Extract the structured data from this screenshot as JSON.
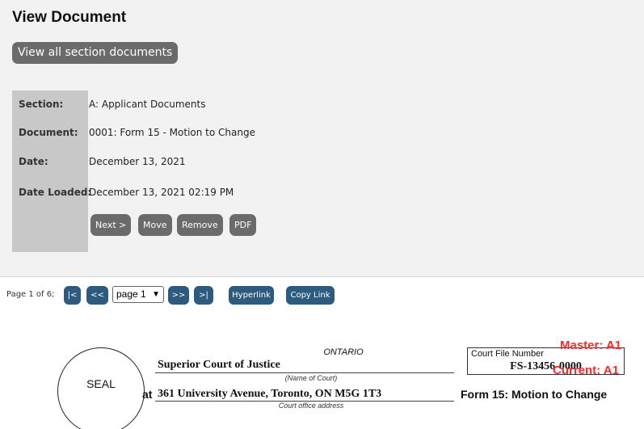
{
  "header": {
    "title": "View Document",
    "view_all_label": "View all section documents"
  },
  "meta": [
    {
      "label": "Section:",
      "value": "A: Applicant Documents"
    },
    {
      "label": "Document:",
      "value": "0001: Form 15 - Motion to Change"
    },
    {
      "label": "Date:",
      "value": "December 13, 2021"
    },
    {
      "label": "Date Loaded:",
      "value": "December 13, 2021 02:19 PM"
    }
  ],
  "actions": {
    "next": "Next >",
    "move": "Move",
    "remove": "Remove",
    "pdf": "PDF"
  },
  "pager": {
    "text": "Page 1 of 6;",
    "first": "|<",
    "prev": "<<",
    "selected_page": "page 1",
    "next": ">>",
    "last": ">|",
    "hyperlink": "Hyperlink",
    "copy_link": "Copy Link"
  },
  "document": {
    "seal": "SEAL",
    "ontario": "ONTARIO",
    "court_name": "Superior Court of Justice",
    "court_caption": "(Name of Court)",
    "at": "at",
    "address": "361 University Avenue, Toronto, ON M5G 1T3",
    "address_caption": "Court office address",
    "file_label": "Court File Number",
    "file_number": "FS-13456-0000",
    "form_title": "Form 15: Motion to Change",
    "stamp_master": "Master: A1",
    "stamp_current": "Current: A1"
  },
  "colors": {
    "button_gray": "#6b6b6b",
    "nav_blue": "#2d5b80",
    "stamp_red": "#ff2a2a",
    "label_col": "#c8c8c8"
  }
}
